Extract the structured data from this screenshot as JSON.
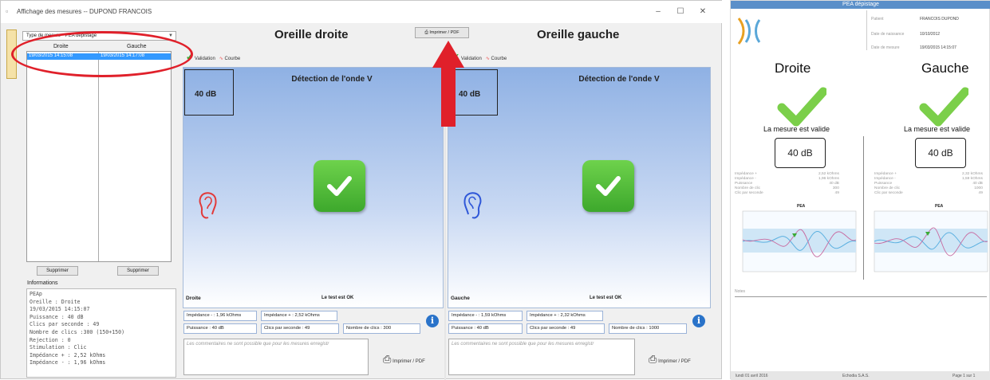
{
  "window": {
    "title": "Affichage des mesures -- DUPOND FRANCOIS",
    "min_label": "–",
    "max_label": "☐",
    "close_label": "✕"
  },
  "left": {
    "type_label": "Type de mesure",
    "type_value": "PEA dépistage",
    "col_right": "Droite",
    "col_left": "Gauche",
    "row_right": "19/03/2015 14:15:08",
    "row_left": "19/03/2015 14:17:08",
    "delete_label": "Supprimer",
    "info_label": "Informations",
    "info_text": "PEAp\nOreille : Droite\n19/03/2015 14:15:07\nPuissance : 40 dB\nClics par seconde : 49\nNombre de clics :300 (150+150)\nRejection : 0\nStimulation : Clic\nImpédance + : 2,52 kOhms\nImpédance - : 1,96 kOhms"
  },
  "top_print_label": "Imprimer / PDF",
  "ears": {
    "right": {
      "title": "Oreille droite",
      "tab_validation": "Validation",
      "tab_curve": "Courbe",
      "db": "40 dB",
      "panel_title": "Détection de l'onde V",
      "side": "Droite",
      "result": "Le test est OK",
      "imp_minus": "Impédance - : 1,96 kOhms",
      "imp_plus": "Impédance + : 2,52 kOhms",
      "power": "Puissance : 40 dB",
      "clicks_per_sec": "Clics par seconde : 49",
      "clicks_count": "Nombre de clics : 300",
      "comment": "Les commentaires ne sont possible que pour les mesures enregistr",
      "print_label": "Imprimer / PDF",
      "ear_color": "#e23a3a"
    },
    "left": {
      "title": "Oreille gauche",
      "tab_validation": "Validation",
      "tab_curve": "Courbe",
      "db": "40 dB",
      "panel_title": "Détection de l'onde V",
      "side": "Gauche",
      "result": "Le test est OK",
      "imp_minus": "Impédance - : 1,59 kOhms",
      "imp_plus": "Impédance + : 2,32 kOhms",
      "power": "Puissance : 40 dB",
      "clicks_per_sec": "Clics par seconde : 49",
      "clicks_count": "Nombre de clics : 1000",
      "comment": "Les commentaires ne sont possible que pour les mesures enregistr",
      "print_label": "Imprimer / PDF",
      "ear_color": "#2f57d8"
    }
  },
  "report": {
    "header": "PEA dépistage",
    "patient_label": "Patient",
    "patient_value": "FRANCOIS DUPOND",
    "birth_label": "Date de naissance",
    "birth_value": "10/10/2012",
    "measure_label": "Date de mesure",
    "measure_value": "19/03/2015 14:15:07",
    "right": {
      "label": "Droite",
      "valid": "La mesure est valide",
      "db": "40 dB",
      "stat_labels": "Impédance +\nImpédance -\nPuissance\nNombre de clic\nClic par seconde",
      "stat_values": "2,52 kOhms\n1,96 kOhms\n40 dB\n300\n49",
      "chart_title": "PEA"
    },
    "left": {
      "label": "Gauche",
      "valid": "La mesure est valide",
      "db": "40 dB",
      "stat_labels": "Impédance +\nImpédance -\nPuissance\nNombre de clic\nClic par seconde",
      "stat_values": "2,32 kOhms\n1,59 kOhms\n40 dB\n1000\n49",
      "chart_title": "PEA"
    },
    "notes_label": "Notes",
    "footer_date": "lundi 01 avril 2016",
    "footer_company": "Echodia S.A.S.",
    "footer_page": "Page 1 sur 1"
  },
  "colors": {
    "check_green": "#4cbb37",
    "accent_blue": "#2a73c9",
    "annotation_red": "#e0202a",
    "curve_blue": "#5bb0e0",
    "curve_pink": "#c86aa0"
  }
}
